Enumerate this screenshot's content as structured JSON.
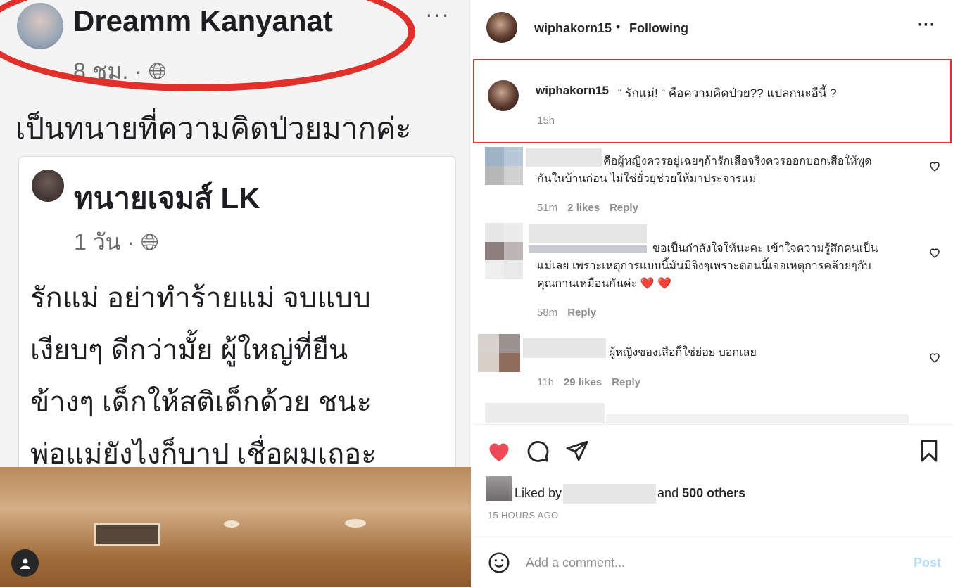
{
  "left_image": {
    "fb_post": {
      "author": "Dreamm Kanyanat",
      "time": "8 ชม. · ",
      "more": "···",
      "text": "เป็นทนายที่ความคิดป่วยมากค่ะ"
    },
    "shared_post": {
      "author": "ทนายเจมส์ LK",
      "time": "1 วัน · ",
      "lines": [
        "รักแม่ อย่าทำร้ายแม่ จบแบบ",
        "เงียบๆ ดีกว่ามั้ย ผู้ใหญ่ที่ยืน",
        "ข้างๆ เด็กให้สติเด็กด้วย ชนะ",
        "พ่อแม่ยังไงก็บาป เชื่อผมเถอะ"
      ]
    }
  },
  "header": {
    "username": "wiphakorn15",
    "dot": "•",
    "follow": "Following",
    "more": "···"
  },
  "caption": {
    "username": "wiphakorn15",
    "text": "“ รักแม่! “ คือความคิดป่วย?? แปลกนะอีนี้ ?",
    "time": "15h"
  },
  "comments": [
    {
      "text_lines": [
        "คือผู้หญิงควรอยู่เฉยๆถ้ารักเสือจริงควรออกบอกเสือให้พูด",
        "กันในบ้านก่อน ไม่ใช่ยั่วยุช่วยให้มาประจารแม่"
      ],
      "time": "51m",
      "likes": "2 likes",
      "reply": "Reply"
    },
    {
      "text_lines": [
        "ขอเป็นกำลังใจให้นะคะ เข้าใจความรู้สึกคนเป็น",
        "แม่เลย เพราะเหตุการแบบนี้มันมีจิงๆเพราะตอนนี้เจอเหตุการคล้ายๆกับ",
        "คุณกานเหมือนกันค่ะ ❤️ ❤️"
      ],
      "time": "58m",
      "likes": "",
      "reply": "Reply"
    },
    {
      "text_lines": [
        "ผู้หญิงของเสือก็ใช่ย่อย บอกเลย"
      ],
      "time": "11h",
      "likes": "29 likes",
      "reply": "Reply"
    }
  ],
  "actions": {
    "liked_prefix": "Liked by",
    "liked_and": "and",
    "liked_others": "500 others",
    "time_ago": "15 HOURS AGO"
  },
  "add_comment": {
    "placeholder": "Add a comment...",
    "post": "Post"
  },
  "colors": {
    "highlight_red": "#e0302b",
    "like_red": "#ed4956",
    "post_disabled": "#b3dbff"
  }
}
